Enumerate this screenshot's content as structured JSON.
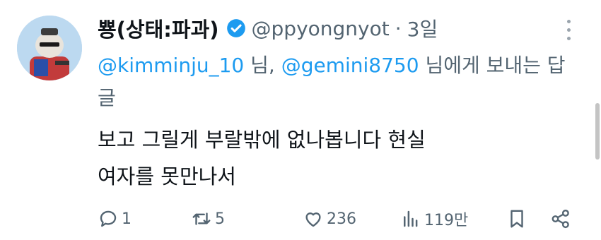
{
  "tweet": {
    "display_name": "뿅(상태:파과)",
    "handle": "@ppyongnyot",
    "separator": "·",
    "time": "3일",
    "reply_to": {
      "mention_1": "@kimminju_10",
      "suffix_1": " 님, ",
      "mention_2": "@gemini8750",
      "suffix_2": " 님에게 보내는 답글"
    },
    "body_lines": [
      "보고 그릴게 부랄밖에 없나봅니다 현실",
      "여자를 못만나서"
    ]
  },
  "actions": {
    "replies": "1",
    "retweets": "5",
    "likes": "236",
    "views": "119만"
  },
  "colors": {
    "accent": "#1d9bf0",
    "secondary_text": "#536471",
    "primary_text": "#0f1419"
  },
  "icons": [
    "more-icon",
    "verified-badge-icon",
    "reply-icon",
    "retweet-icon",
    "like-icon",
    "views-icon",
    "bookmark-icon",
    "share-icon"
  ]
}
